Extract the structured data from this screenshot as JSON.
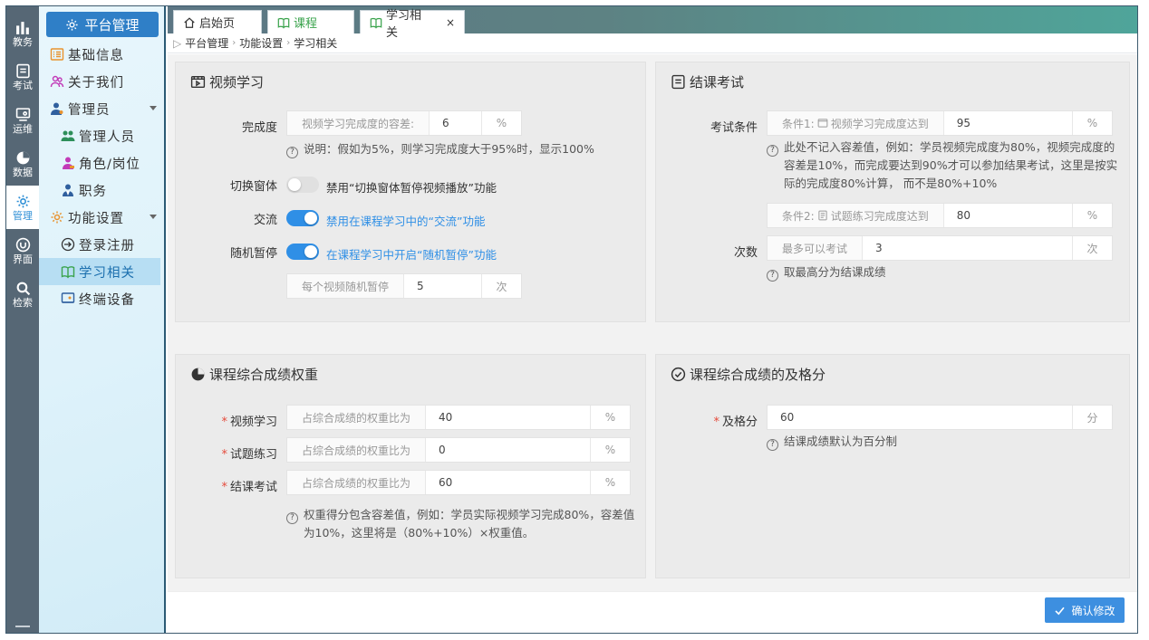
{
  "rail": [
    {
      "label": "教务",
      "icon": "bar-chart-icon"
    },
    {
      "label": "考试",
      "icon": "exam-icon"
    },
    {
      "label": "运维",
      "icon": "monitor-icon"
    },
    {
      "label": "数据",
      "icon": "pie-icon"
    },
    {
      "label": "管理",
      "icon": "gear-icon",
      "active": true
    },
    {
      "label": "界面",
      "icon": "ui-icon"
    },
    {
      "label": "检索",
      "icon": "search-icon"
    }
  ],
  "sidebar": {
    "title": "平台管理",
    "items": [
      {
        "label": "基础信息"
      },
      {
        "label": "关于我们"
      },
      {
        "label": "管理员"
      },
      {
        "label": "管理人员"
      },
      {
        "label": "角色/岗位"
      },
      {
        "label": "职务"
      },
      {
        "label": "功能设置"
      },
      {
        "label": "登录注册"
      },
      {
        "label": "学习相关"
      },
      {
        "label": "终端设备"
      }
    ]
  },
  "tabs": [
    {
      "label": "启始页"
    },
    {
      "label": "课程"
    },
    {
      "label": "学习相关",
      "close": "×"
    }
  ],
  "breadcrumb": [
    "平台管理",
    "功能设置",
    "学习相关"
  ],
  "video": {
    "title": "视频学习",
    "completion_label": "完成度",
    "completion_prefix": "视频学习完成度的容差:",
    "completion_value": "6",
    "completion_suffix": "%",
    "completion_note": "说明：假如为5%，则学习完成度大于95%时，显示100%",
    "switch_window_label": "切换窗体",
    "switch_window_text": "禁用“切换窗体暂停视频播放”功能",
    "exchange_label": "交流",
    "exchange_text": "禁用在课程学习中的“交流”功能",
    "pause_label": "随机暂停",
    "pause_text": "在课程学习中开启“随机暂停”功能",
    "pause_prefix": "每个视频随机暂停",
    "pause_value": "5",
    "pause_suffix": "次"
  },
  "exam": {
    "title": "结课考试",
    "cond_label": "考试条件",
    "cond1_prefix": "条件1:",
    "cond1_text": "视频学习完成度达到",
    "cond1_value": "95",
    "cond1_suffix": "%",
    "cond1_note_1": "此处不记入容差值，例如：学员视频完成度为80%，视频完成度的",
    "cond1_note_2": "容差是10%，而完成要达到90%才可以参加结果考试，这里是按实",
    "cond1_note_3": "际的完成度80%计算， 而不是80%+10%",
    "cond2_prefix": "条件2:",
    "cond2_text": "试题练习完成度达到",
    "cond2_value": "80",
    "cond2_suffix": "%",
    "times_label": "次数",
    "times_prefix": "最多可以考试",
    "times_value": "3",
    "times_suffix": "次",
    "times_note": "取最高分为结课成绩"
  },
  "weight": {
    "title": "课程综合成绩权重",
    "rows": [
      {
        "label": "视频学习",
        "prefix": "占综合成绩的权重比为",
        "value": "40",
        "suffix": "%"
      },
      {
        "label": "试题练习",
        "prefix": "占综合成绩的权重比为",
        "value": "0",
        "suffix": "%"
      },
      {
        "label": "结课考试",
        "prefix": "占综合成绩的权重比为",
        "value": "60",
        "suffix": "%"
      }
    ],
    "note_1": "权重得分包含容差值，例如：学员实际视频学习完成80%，容差值",
    "note_2": "为10%，这里将是（80%+10%）×权重值。"
  },
  "pass": {
    "title": "课程综合成绩的及格分",
    "label": "及格分",
    "value": "60",
    "suffix": "分",
    "note": "结课成绩默认为百分制"
  },
  "footer": {
    "confirm": "确认修改"
  },
  "colors": {
    "accent": "#2f8fe6",
    "sidebar_active": "#b7def3",
    "required": "#e54b3c"
  }
}
